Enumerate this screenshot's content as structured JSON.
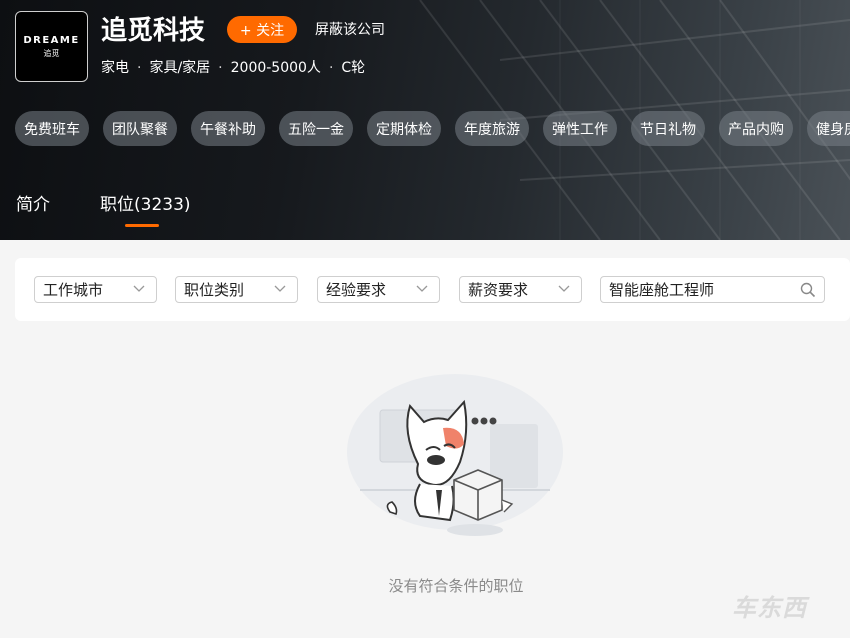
{
  "company": {
    "logo_text": "DREAME",
    "logo_sub": "追觅",
    "name": "追觅科技",
    "follow_label": "+ 关注",
    "block_label": "屏蔽该公司",
    "meta": [
      "家电",
      "家具/家居",
      "2000-5000人",
      "C轮"
    ]
  },
  "benefits": [
    "免费班车",
    "团队聚餐",
    "午餐补助",
    "五险一金",
    "定期体检",
    "年度旅游",
    "弹性工作",
    "节日礼物",
    "产品内购",
    "健身房"
  ],
  "tabs": [
    {
      "label": "简介",
      "active": false
    },
    {
      "label": "职位(3233)",
      "active": true
    }
  ],
  "filters": [
    {
      "label": "工作城市"
    },
    {
      "label": "职位类别"
    },
    {
      "label": "经验要求"
    },
    {
      "label": "薪资要求"
    }
  ],
  "search": {
    "value": "智能座舱工程师"
  },
  "empty_state": {
    "message": "没有符合条件的职位"
  },
  "watermark": "车东西",
  "colors": {
    "accent": "#ff6a00",
    "header_bg": "#16191d",
    "page_bg": "#f5f5f5"
  },
  "icons": {
    "search": "search-icon",
    "chevron": "chevron-down-icon"
  }
}
